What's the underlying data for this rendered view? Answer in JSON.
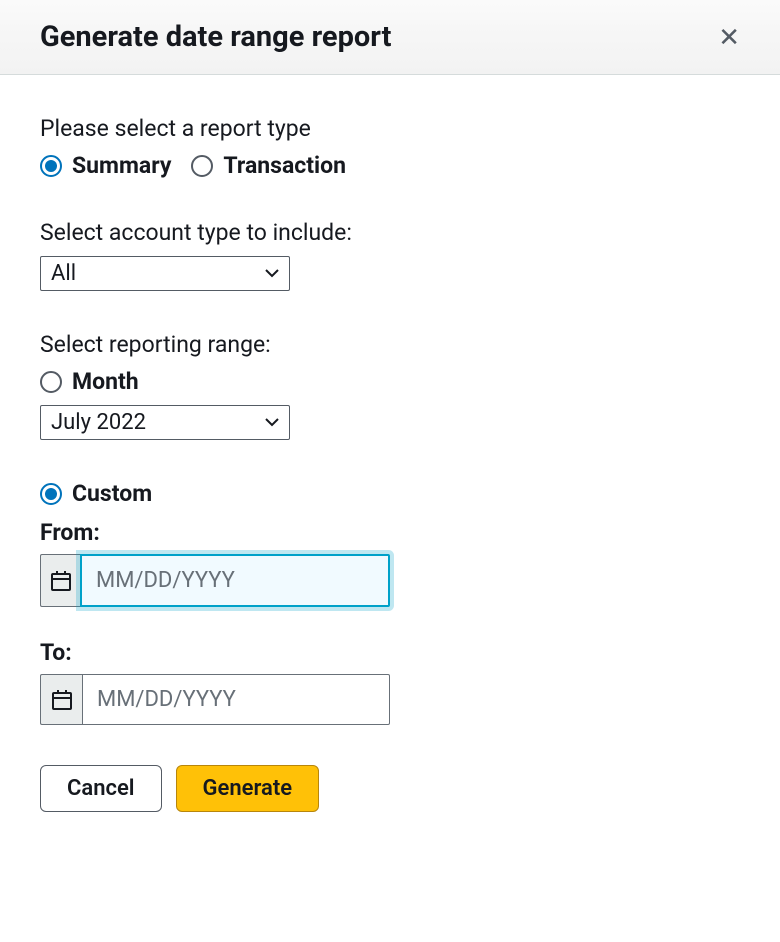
{
  "header": {
    "title": "Generate date range report"
  },
  "reportType": {
    "label": "Please select a report type",
    "summary": "Summary",
    "transaction": "Transaction"
  },
  "accountType": {
    "label": "Select account type to include:",
    "value": "All"
  },
  "reportingRange": {
    "label": "Select reporting range:",
    "month": "Month",
    "monthValue": "July 2022",
    "custom": "Custom",
    "fromLabel": "From:",
    "fromPlaceholder": "MM/DD/YYYY",
    "toLabel": "To:",
    "toPlaceholder": "MM/DD/YYYY"
  },
  "buttons": {
    "cancel": "Cancel",
    "generate": "Generate"
  }
}
